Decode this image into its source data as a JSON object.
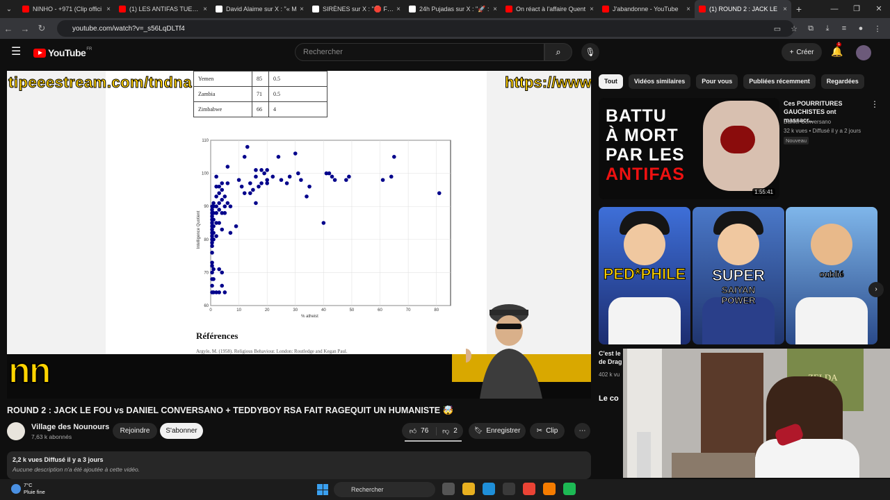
{
  "browser": {
    "tabs": [
      {
        "title": "NINHO - +971 (Clip offici",
        "color": "#ff0000"
      },
      {
        "title": "(1) LES ANTIFAS TUENT C",
        "color": "#ff0000"
      },
      {
        "title": "David Alaime sur X : \"« M",
        "color": "#ffffff"
      },
      {
        "title": "SIRÈNES sur X : \"🛑 FLAS",
        "color": "#ffffff"
      },
      {
        "title": "24h Pujadas sur X : \"🚀 :",
        "color": "#ffffff"
      },
      {
        "title": "On réact à l'affaire Quent",
        "color": "#ff0000"
      },
      {
        "title": "J'abandonne - YouTube",
        "color": "#ff0000"
      },
      {
        "title": "(1) ROUND 2 : JACK LE",
        "color": "#ff0000",
        "active": true
      }
    ],
    "url": "youtube.com/watch?v=_s56LqDLTf4"
  },
  "header": {
    "logo_text": "YouTube",
    "country": "FR",
    "search_placeholder": "Rechercher",
    "create_label": "Créer",
    "notif_count": "1"
  },
  "video": {
    "overlay_left": "tipeeestream.com/tndna",
    "overlay_right": "https://www",
    "overlay_big": "nn",
    "table": [
      {
        "country": "Yemen",
        "iq": "85",
        "atheist": "0.5"
      },
      {
        "country": "Zambia",
        "iq": "71",
        "atheist": "0.5"
      },
      {
        "country": "Zimbabwe",
        "iq": "66",
        "atheist": "4"
      }
    ],
    "references_heading": "Références",
    "references_line": "Argyle, M. (1958). Religious Behaviour. London: Routledge and Kegan Paul."
  },
  "chart_data": {
    "type": "scatter",
    "xlabel": "% atheist",
    "ylabel": "Intelligence Quotient",
    "xlim": [
      0,
      85
    ],
    "ylim": [
      60,
      110
    ],
    "xticks": [
      0,
      10,
      20,
      30,
      40,
      50,
      60,
      70,
      80
    ],
    "yticks": [
      60,
      70,
      80,
      90,
      100,
      110
    ],
    "grid": true,
    "color": "#00008b",
    "points": [
      [
        0.5,
        64
      ],
      [
        0.5,
        66
      ],
      [
        0.5,
        68
      ],
      [
        0.5,
        70
      ],
      [
        0.5,
        72
      ],
      [
        0.5,
        73
      ],
      [
        0.5,
        76
      ],
      [
        0.5,
        78
      ],
      [
        0.5,
        79
      ],
      [
        0.5,
        80
      ],
      [
        0.5,
        81
      ],
      [
        0.5,
        82
      ],
      [
        0.5,
        83
      ],
      [
        0.5,
        84
      ],
      [
        0.5,
        85
      ],
      [
        0.5,
        86
      ],
      [
        0.5,
        87
      ],
      [
        0.5,
        88
      ],
      [
        0.5,
        89
      ],
      [
        0.5,
        90
      ],
      [
        1,
        64
      ],
      [
        1,
        68
      ],
      [
        1,
        71
      ],
      [
        1,
        80
      ],
      [
        1,
        82
      ],
      [
        1,
        84
      ],
      [
        1,
        86
      ],
      [
        1,
        88
      ],
      [
        1,
        90
      ],
      [
        1,
        91
      ],
      [
        2,
        64
      ],
      [
        2,
        81
      ],
      [
        2,
        85
      ],
      [
        2,
        88
      ],
      [
        2,
        90
      ],
      [
        2,
        93
      ],
      [
        2,
        96
      ],
      [
        2,
        99
      ],
      [
        3,
        64
      ],
      [
        3,
        71
      ],
      [
        3,
        85
      ],
      [
        3,
        89
      ],
      [
        3,
        91
      ],
      [
        3,
        94
      ],
      [
        3,
        96
      ],
      [
        4,
        66
      ],
      [
        4,
        70
      ],
      [
        4,
        83
      ],
      [
        4,
        88
      ],
      [
        4,
        92
      ],
      [
        4,
        95
      ],
      [
        4,
        97
      ],
      [
        5,
        64
      ],
      [
        5,
        88
      ],
      [
        5,
        90
      ],
      [
        5,
        93
      ],
      [
        6,
        91
      ],
      [
        6,
        97
      ],
      [
        6,
        102
      ],
      [
        7,
        82
      ],
      [
        7,
        90
      ],
      [
        9,
        84
      ],
      [
        10,
        98
      ],
      [
        11,
        96
      ],
      [
        12,
        94
      ],
      [
        12,
        105
      ],
      [
        13,
        108
      ],
      [
        14,
        94
      ],
      [
        14,
        97
      ],
      [
        15,
        95
      ],
      [
        16,
        91
      ],
      [
        16,
        99
      ],
      [
        16,
        101
      ],
      [
        17,
        96
      ],
      [
        18,
        97
      ],
      [
        18,
        101
      ],
      [
        19,
        100
      ],
      [
        20,
        97
      ],
      [
        20,
        98
      ],
      [
        20,
        101
      ],
      [
        22,
        99
      ],
      [
        24,
        105
      ],
      [
        25,
        98
      ],
      [
        27,
        97
      ],
      [
        28,
        99
      ],
      [
        30,
        106
      ],
      [
        31,
        100
      ],
      [
        32,
        98
      ],
      [
        34,
        93
      ],
      [
        35,
        96
      ],
      [
        40,
        85
      ],
      [
        41,
        100
      ],
      [
        42,
        100
      ],
      [
        43,
        99
      ],
      [
        44,
        98
      ],
      [
        48,
        98
      ],
      [
        49,
        99
      ],
      [
        61,
        98
      ],
      [
        64,
        99
      ],
      [
        65,
        105
      ],
      [
        81,
        94
      ]
    ]
  },
  "meta": {
    "title": "ROUND 2 : JACK LE FOU vs DANIEL CONVERSANO + TEDDYBOY RSA FAIT RAGEQUIT UN HUMANISTE 🤯",
    "channel": "Village des Nounours",
    "subs": "7,63 k abonnés",
    "join": "Rejoindre",
    "subscribe": "S'abonner",
    "likes": "76",
    "dislikes": "2",
    "save": "Enregistrer",
    "clip": "Clip",
    "views_date": "2,2 k vues  Diffusé il y a 3 jours",
    "description": "Aucune description n'a été ajoutée à cette vidéo."
  },
  "sidebar": {
    "chips": [
      "Tout",
      "Vidéos similaires",
      "Pour vous",
      "Publiées récemment",
      "Regardées"
    ],
    "rec1": {
      "thumb_lines": [
        "BATTU",
        "À MORT",
        "PAR LES",
        "ANTIFAS"
      ],
      "duration": "1:55:41",
      "title": "Ces POURRITURES GAUCHISTES ont massacr...",
      "channel": "Daniel Conversano",
      "views": "32 k vues • Diffusé il y a 2 jours",
      "badge": "Nouveau"
    },
    "shorts": [
      {
        "caption": "PED*PHILE",
        "caption_color": "#ffd400"
      },
      {
        "caption": "SUPER",
        "sub": "SAIYAN POWER",
        "caption_color": "#ffffff"
      },
      {
        "caption": "oublié",
        "caption_color": "#ffffff"
      }
    ],
    "rec2_title": "C'est le",
    "rec2_title2": "de Drag",
    "rec2_views": "402 k vu",
    "rec3_thumb": "Le co",
    "webcam_poster": "ZELDA"
  },
  "taskbar": {
    "temp": "7°C",
    "weather": "Pluie fine",
    "search": "Rechercher"
  }
}
